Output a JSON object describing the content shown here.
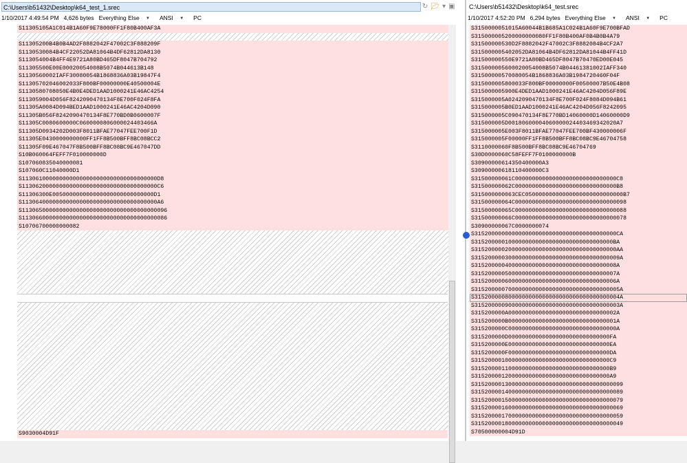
{
  "left": {
    "path": "C:\\Users\\b51432\\Desktop\\k64_test_1.srec",
    "info": {
      "timestamp": "1/10/2017 4:49:54 PM",
      "size": "4,626 bytes",
      "format": "Everything Else",
      "encoding": "ANSI",
      "line_endings": "PC"
    },
    "lines_top": [
      "S11305105A1C014B1A60F9E78000FF1F80B400AF3A",
      "",
      "S11305200B4B0B4AD2F8882042F47002C3F888209F",
      "S1130530084B4CF22052DA81064B4DF62812DA8130",
      "S113054004B4FF4E9721A80BD465DF8047B704792",
      "S11305500E00E00020054008B5074B044613B148",
      "S1130560002IAFF30080054B1868836A03B19847F4",
      "S11305702046002033F800BF00000000E40500004E",
      "S1130580708050E4B0E4DED1AAD1000241E46AC4254",
      "S113059004D056F8242090470134F8E700F024F8FA",
      "S11305A0084D094BED1AAD1000241E46AC4204D090",
      "S11305B056F8242090470134F8E770BD0B0600007F",
      "S11305C0080600000C0600000806000024403466A",
      "S11305D0934202D003F8011BFAE77047FEE700F1D",
      "S11305E0430000000000FF1FF8B500BFF8BC08BCC2",
      "S11305F09E467047F8B500BFF8BC08BC9E467047DD",
      "S10B060064FEFF7F010000000D",
      "S107060835040000081",
      "S107060C11040000D1",
      "S1130610000000000000000000000000000000000D8",
      "S1130620000000000000000000000000000000000C6",
      "S11306300E005000000000000000000000000000D1",
      "S1130640000000000000000000000000000000000A6",
      "S1130650000000000000000000000000000000000096",
      "S1130660000000000000000000000000000000000086",
      "S10706700000000082"
    ],
    "last_line": "S9030004D91F"
  },
  "right": {
    "path": "C:\\Users\\b51432\\Desktop\\k64_test.srec",
    "info": {
      "timestamp": "1/10/2017 4:52:20 PM",
      "size": "6,294 bytes",
      "format": "Everything Else",
      "encoding": "ANSI",
      "line_endings": "PC"
    },
    "lines": [
      "S3150000051015A60044B1B685A1C024B1A60F9E700BFAD",
      "S315000005200000000080FF1F80B400AF0B4B0B4A79",
      "S31500000530D2F8882042F47002C3F8882084B4CF2A7",
      "S315000005402052DA81064B4DF62812DA81044B4FF41D",
      "S31500000550E9721A80BD465DF8047B70470ED00E045",
      "S315000005600020054008B5074B04461381002IAFF340",
      "S31500000570080054B1868836A03B1984720460F04F",
      "S315000005800033F800BF00000000F00500007B50E4B08",
      "S315000005900E4DED1AAD1000241E46AC4204D056F89E",
      "S315000005A0242090470134F8E700F024F8084D094B61",
      "S315000005B0ED1AAD1000241E46AC4204D056F8242095",
      "S315000005C090470134F8E770BD14060000D14060000D9",
      "S315000005D00180600004060000024403469342020A7",
      "S315000005E003F8011BFAE77047FEE700BF430000006F",
      "S315000005F00000FF1FF8B500BFF8BC08BC9E46704758",
      "S3110000060F8B500BFF8BC08BC9E46704769",
      "S30D0000060C58FEFF7F0100000000B",
      "S30900000614350400000A3",
      "S30900000618110400000C3",
      "S31500000061C000000000000000000000000000000C8",
      "S31500000062C000000000000000000000000000000B8",
      "S315000000063CEC05000000000000000000000000000B7",
      "S31500000064C000000000000000000000000000000098",
      "S31500000065C000000000000000000000000000000088",
      "S31500000066C000000000000000000000000000000078",
      "S30900000067C0000000074",
      "S315200000000000000000000000000000000000000CA",
      "S31520000010000000000000000000000000000000BA",
      "S315200000200000000000000000000000000000000AA",
      "S3152000003000000000000000000000000000000009A",
      "S315200000400000000000000000000000000000008A",
      "S315200000500000000000000000000000000000007A",
      "S315200000600000000000000000000000000000006A",
      "S3152000007000000000000000000000000000000005A",
      "S3152000008000000000000000000000000000000004A",
      "S3152000009000000000000000000000000000000003A",
      "S315200000A00000000000000000000000000000002A",
      "S315200000B00000000000000000000000000000001A",
      "S315200000C00000000000000000000000000000000A",
      "S315200000D000000000000000000000000000000FA",
      "S315200000E000000000000000000000000000000EA",
      "S315200000F000000000000000000000000000000DA",
      "S3152000010000000000000000000000000000000C9",
      "S3152000011000000000000000000000000000000B9",
      "S3152000012000000000000000000000000000000A9",
      "S31520000130000000000000000000000000000000099",
      "S31520000140000000000000000000000000000000089",
      "S31520000150000000000000000000000000000000079",
      "S31520000160000000000000000000000000000000069",
      "S31520000170000000000000000000000000000000059",
      "S31520000180000000000000000000000000000000049",
      "S70500000004D91D"
    ]
  },
  "icons": [
    "refresh-icon",
    "folder-open-icon",
    "save-icon"
  ],
  "colors": {
    "diff_bg": "#ffe0e0",
    "diff_text": "#e01818",
    "selection_bar": "#dbe8f8"
  }
}
